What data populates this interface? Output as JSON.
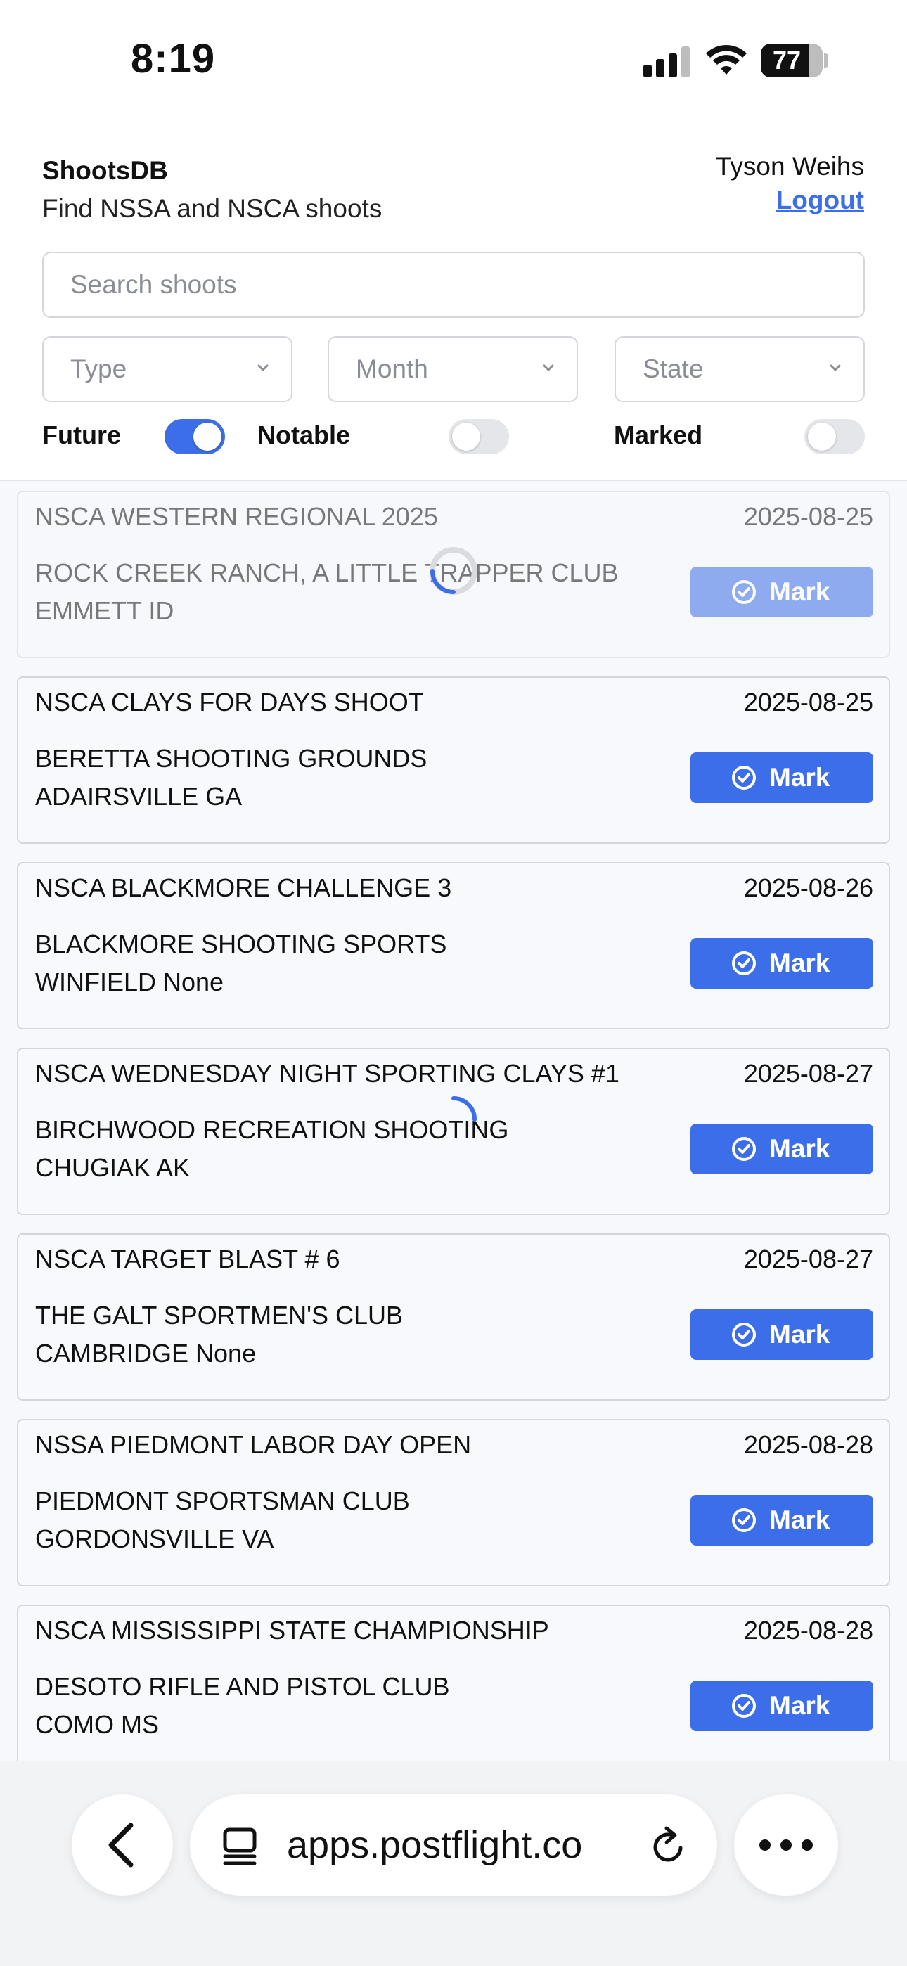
{
  "status_bar": {
    "time": "8:19",
    "battery": "77",
    "battery_level": 0.77
  },
  "header": {
    "app_title": "ShootsDB",
    "subtitle": "Find NSSA and NSCA shoots",
    "user_name": "Tyson Weihs",
    "logout_label": "Logout"
  },
  "search": {
    "placeholder": "Search shoots",
    "value": ""
  },
  "filters": {
    "type": "Type",
    "month": "Month",
    "state": "State"
  },
  "toggles": {
    "future": {
      "label": "Future",
      "on": true
    },
    "notable": {
      "label": "Notable",
      "on": false
    },
    "marked": {
      "label": "Marked",
      "on": false
    }
  },
  "events": [
    {
      "name": "NSCA WESTERN REGIONAL 2025",
      "date": "2025-08-25",
      "venue": "ROCK CREEK RANCH, A LITTLE TRAPPER CLUB",
      "location": "EMMETT ID",
      "button": "Mark",
      "loading": true
    },
    {
      "name": "NSCA CLAYS FOR DAYS SHOOT",
      "date": "2025-08-25",
      "venue": "BERETTA SHOOTING GROUNDS",
      "location": "ADAIRSVILLE GA",
      "button": "Mark",
      "loading": false
    },
    {
      "name": "NSCA BLACKMORE CHALLENGE 3",
      "date": "2025-08-26",
      "venue": "BLACKMORE SHOOTING SPORTS",
      "location": "WINFIELD None",
      "button": "Mark",
      "loading": false
    },
    {
      "name": "NSCA WEDNESDAY NIGHT SPORTING CLAYS #1",
      "date": "2025-08-27",
      "venue": "BIRCHWOOD RECREATION SHOOTING",
      "location": "CHUGIAK AK",
      "button": "Mark",
      "loading": false
    },
    {
      "name": "NSCA TARGET BLAST # 6",
      "date": "2025-08-27",
      "venue": "THE GALT SPORTMEN'S CLUB",
      "location": "CAMBRIDGE None",
      "button": "Mark",
      "loading": false
    },
    {
      "name": "NSSA PIEDMONT LABOR DAY OPEN",
      "date": "2025-08-28",
      "venue": "PIEDMONT SPORTSMAN CLUB",
      "location": "GORDONSVILLE VA",
      "button": "Mark",
      "loading": false
    },
    {
      "name": "NSCA MISSISSIPPI STATE CHAMPIONSHIP",
      "date": "2025-08-28",
      "venue": "DESOTO RIFLE AND PISTOL CLUB",
      "location": "COMO MS",
      "button": "Mark",
      "loading": false
    }
  ],
  "browser": {
    "url": "apps.postflight.co"
  },
  "colors": {
    "accent": "#3b6ee8",
    "card_bg": "#f8f9fc",
    "card_border": "#d3d6dc"
  },
  "icons": [
    "signal-icon",
    "wifi-icon",
    "battery-icon",
    "chevron-down-icon",
    "check-circle-icon",
    "spinner-icon",
    "back-chevron-icon",
    "tabs-icon",
    "reload-icon",
    "more-icon"
  ]
}
